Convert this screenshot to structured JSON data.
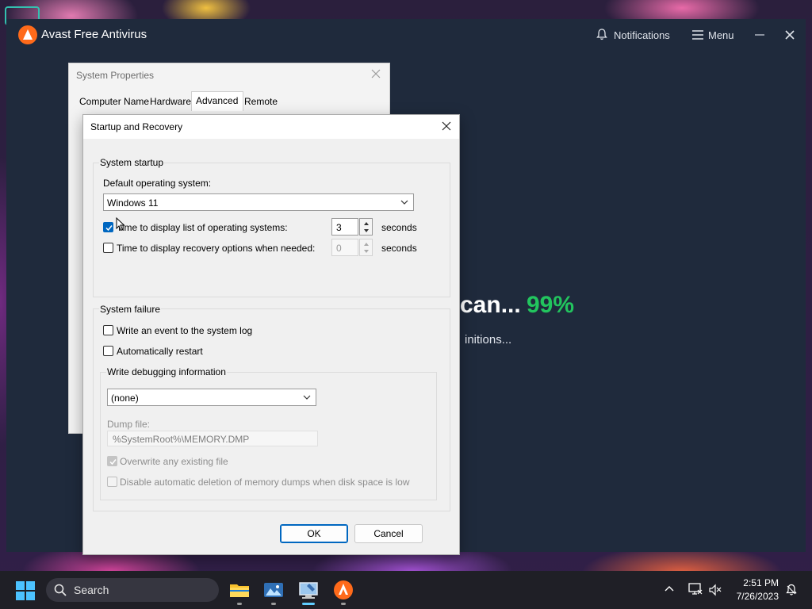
{
  "avast": {
    "title": "Avast Free Antivirus",
    "notifications_label": "Notifications",
    "menu_label": "Menu",
    "scan_title": "can...",
    "scan_percent": "99%",
    "scan_subtitle": "initions...",
    "accent_color": "#ff6a1a",
    "progress_color": "#22c55e"
  },
  "system_properties": {
    "title": "System Properties",
    "tabs": [
      "Computer Name",
      "Hardware",
      "Advanced",
      "Remote"
    ],
    "active_tab": "Advanced"
  },
  "startup_recovery": {
    "title": "Startup and Recovery",
    "system_startup": {
      "group_label": "System startup",
      "default_os_label": "Default operating system:",
      "default_os_value": "Windows 11",
      "display_list_label": "Time to display list of operating systems:",
      "display_list_checked": true,
      "display_list_value": "3",
      "display_list_unit": "seconds",
      "recovery_label": "Time to display recovery options when needed:",
      "recovery_checked": false,
      "recovery_value": "0",
      "recovery_unit": "seconds"
    },
    "system_failure": {
      "group_label": "System failure",
      "write_event_label": "Write an event to the system log",
      "write_event_checked": false,
      "auto_restart_label": "Automatically restart",
      "auto_restart_checked": false,
      "debug_group_label": "Write debugging information",
      "debug_value": "(none)",
      "dump_file_label": "Dump file:",
      "dump_file_value": "%SystemRoot%\\MEMORY.DMP",
      "overwrite_label": "Overwrite any existing file",
      "overwrite_checked": true,
      "disable_auto_delete_label": "Disable automatic deletion of memory dumps when disk space is low",
      "disable_auto_delete_checked": false
    },
    "ok_label": "OK",
    "cancel_label": "Cancel"
  },
  "taskbar": {
    "search_label": "Search",
    "apps": [
      "file-explorer",
      "photos",
      "system-properties",
      "avast"
    ],
    "active_app": "system-properties",
    "time": "2:51 PM",
    "date": "7/26/2023"
  }
}
